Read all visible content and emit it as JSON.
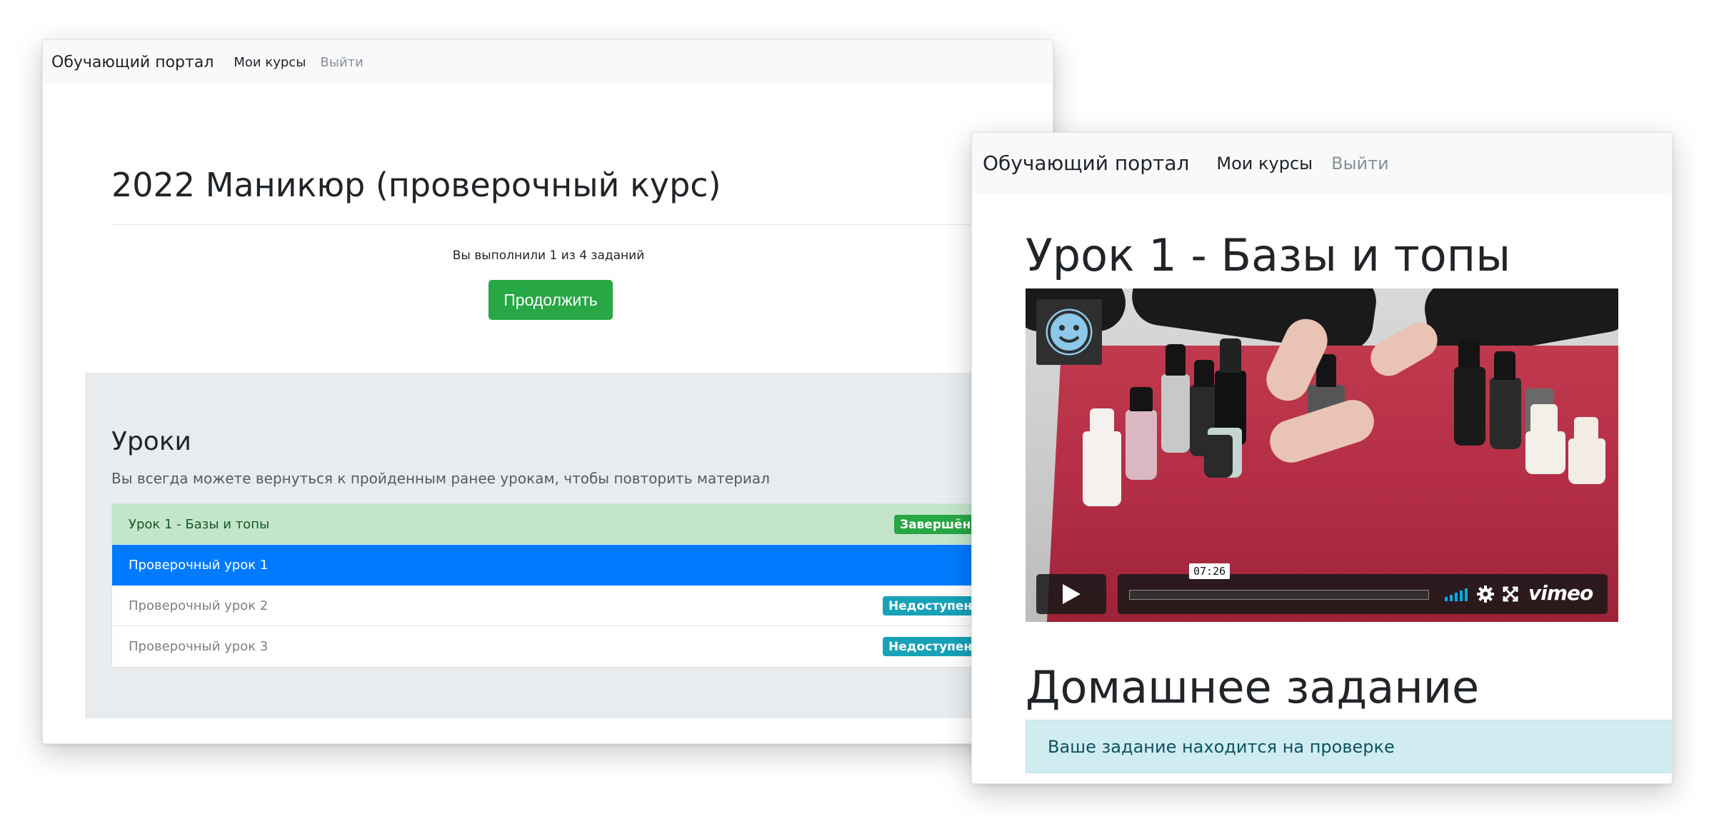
{
  "windows": [
    {
      "navbar": {
        "brand": "Обучающий портал",
        "links": [
          "Мои курсы",
          "Выйти"
        ]
      },
      "course": {
        "title": "2022 Маникюр (проверочный курс)",
        "progress_text": "Вы выполнили 1 из 4 заданий",
        "continue_label": "Продолжить"
      },
      "lessons": {
        "title": "Уроки",
        "description": "Вы всегда можете вернуться к пройденным ранее урокам, чтобы повторить материал",
        "items": [
          {
            "label": "Урок 1 - Базы и топы",
            "badge": "Завершён",
            "state": "done"
          },
          {
            "label": "Проверочный урок 1",
            "badge": "",
            "state": "current"
          },
          {
            "label": "Проверочный урок 2",
            "badge": "Недоступен",
            "state": "locked"
          },
          {
            "label": "Проверочный урок 3",
            "badge": "Недоступен",
            "state": "locked"
          }
        ]
      }
    },
    {
      "navbar": {
        "brand": "Обучающий портал",
        "links": [
          "Мои курсы",
          "Выйти"
        ]
      },
      "lesson_title": "Урок 1 - Базы и топы",
      "video": {
        "time": "07:26",
        "provider": "vimeo"
      },
      "homework": {
        "title": "Домашнее задание",
        "status": "Ваше задание находится на проверке"
      }
    }
  ],
  "colors": {
    "success": "#28a745",
    "primary": "#007bff",
    "info": "#17a2b8",
    "done_row": "#c3e6cb",
    "alert_bg": "#d1ecf1",
    "navbar_bg": "#f8f9fa",
    "vimeo_accent": "#00adef"
  },
  "icons": [
    "play-icon",
    "volume-icon",
    "settings-gear-icon",
    "fullscreen-icon",
    "avatar-smiley-icon"
  ]
}
